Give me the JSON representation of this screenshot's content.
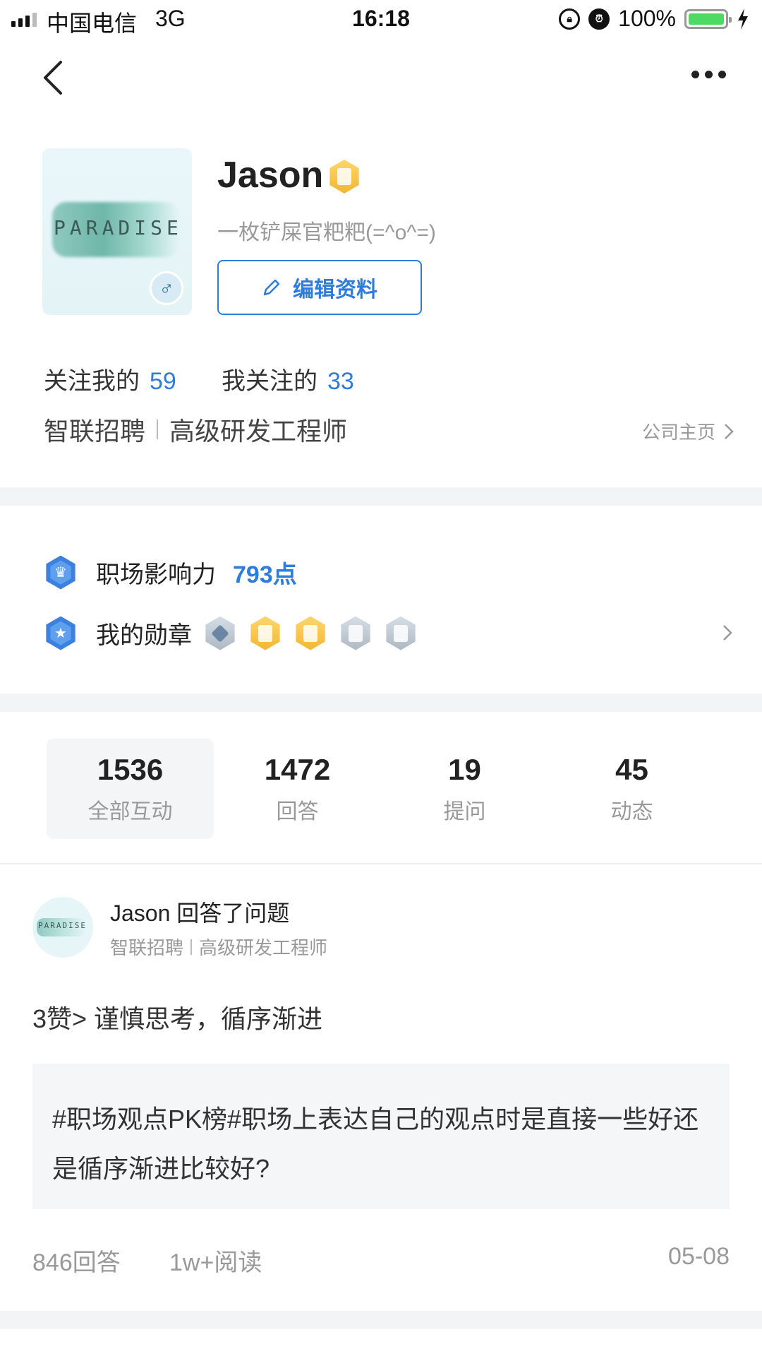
{
  "status_bar": {
    "carrier": "中国电信",
    "network": "3G",
    "time": "16:18",
    "battery": "100%"
  },
  "profile": {
    "name": "Jason",
    "signature": "一枚铲屎官粑粑(=^o^=)",
    "edit_label": "编辑资料",
    "avatar_text": "PARADISE",
    "followers_label": "关注我的",
    "followers_count": "59",
    "following_label": "我关注的",
    "following_count": "33",
    "company": "智联招聘",
    "position": "高级研发工程师",
    "company_link": "公司主页"
  },
  "influence": {
    "label": "职场影响力",
    "points": "793点",
    "medals_label": "我的勋章",
    "medals": [
      "pen-medal-icon",
      "gold-doc-medal-icon",
      "gold-doc-medal-icon",
      "like-medal-icon",
      "calendar-medal-icon"
    ]
  },
  "stats": [
    {
      "num": "1536",
      "label": "全部互动"
    },
    {
      "num": "1472",
      "label": "回答"
    },
    {
      "num": "19",
      "label": "提问"
    },
    {
      "num": "45",
      "label": "动态"
    }
  ],
  "feed": {
    "title": "Jason 回答了问题",
    "company": "智联招聘",
    "position": "高级研发工程师",
    "answer": "3赞> 谨慎思考，循序渐进",
    "question": "#职场观点PK榜#职场上表达自己的观点时是直接一些好还是循序渐进比较好?",
    "answers_count": "846回答",
    "reads": "1w+阅读",
    "date": "05-08"
  },
  "colors": {
    "accent": "#2e7cdc",
    "gold": "#f2b631",
    "separator": "#f3f4f6"
  }
}
